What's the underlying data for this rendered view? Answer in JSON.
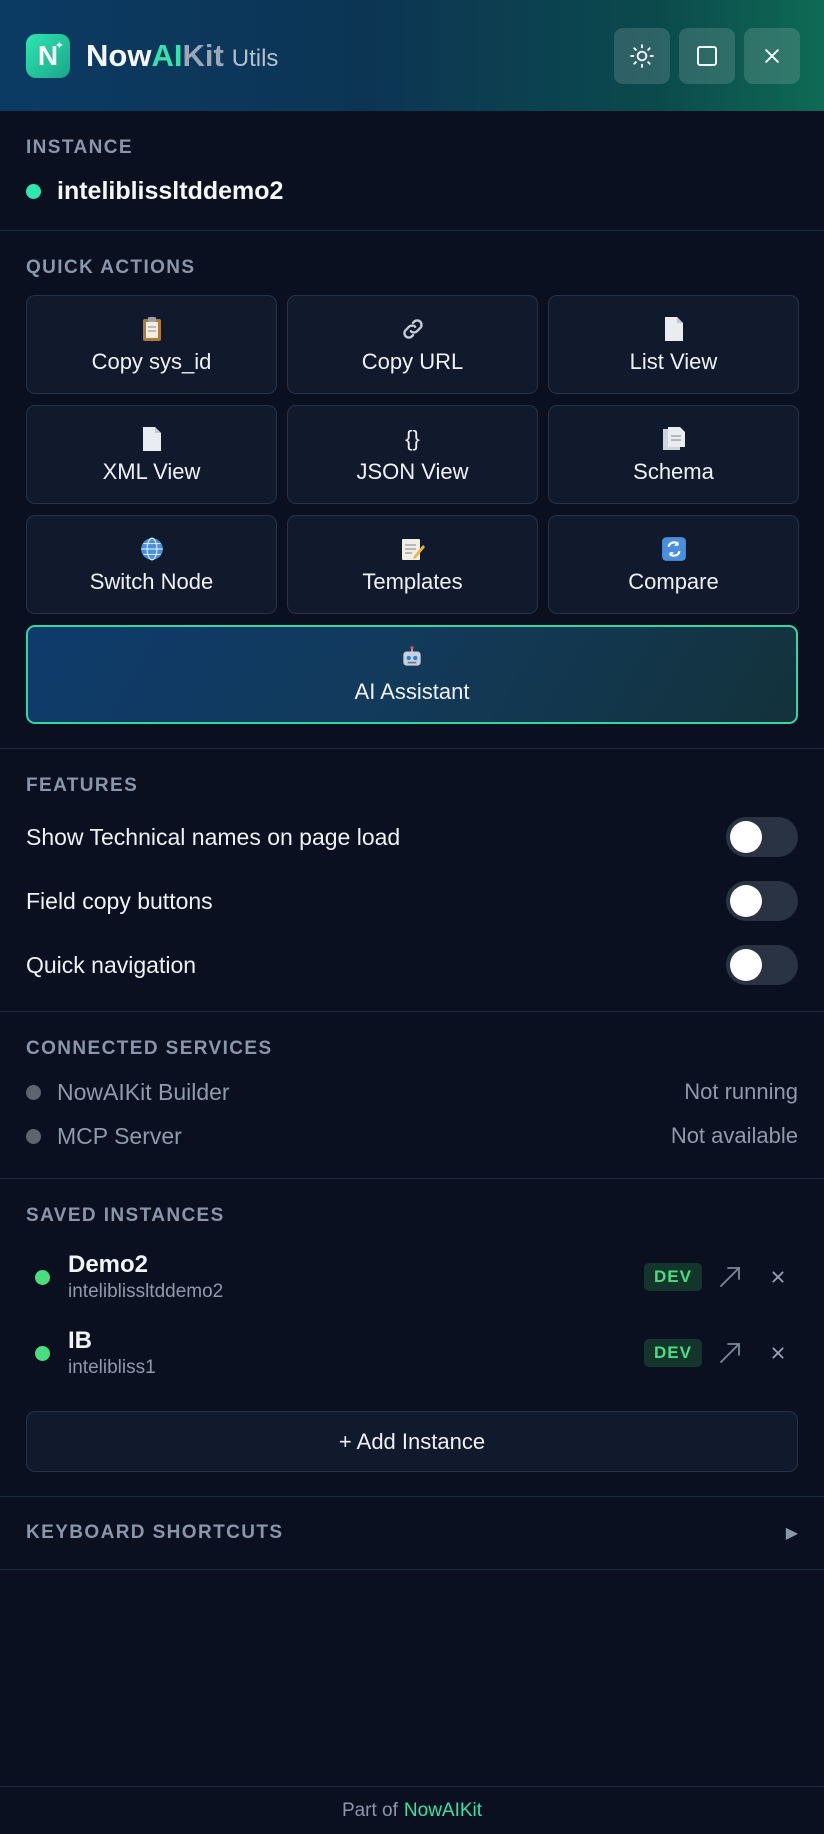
{
  "header": {
    "logo_letter": "N",
    "brand_now": "Now",
    "brand_ai": "AI",
    "brand_kit": "Kit",
    "brand_suffix": "Utils",
    "buttons": [
      {
        "icon": "sun-icon"
      },
      {
        "icon": "square-icon"
      },
      {
        "icon": "close-icon"
      }
    ]
  },
  "instance": {
    "title": "INSTANCE",
    "name": "inteliblissltddemo2",
    "status_color": "#2ee6b0"
  },
  "quick_actions": {
    "title": "QUICK ACTIONS",
    "items": [
      {
        "label": "Copy sys_id",
        "icon": "clipboard-icon"
      },
      {
        "label": "Copy URL",
        "icon": "link-icon"
      },
      {
        "label": "List View",
        "icon": "document-icon"
      },
      {
        "label": "XML View",
        "icon": "document-icon"
      },
      {
        "label": "JSON View",
        "icon": "braces-icon",
        "glyph": "{}"
      },
      {
        "label": "Schema",
        "icon": "schema-icon"
      },
      {
        "label": "Switch Node",
        "icon": "globe-icon"
      },
      {
        "label": "Templates",
        "icon": "memo-icon"
      },
      {
        "label": "Compare",
        "icon": "refresh-icon"
      }
    ],
    "ai_assistant": {
      "label": "AI Assistant",
      "icon": "robot-icon"
    }
  },
  "features": {
    "title": "FEATURES",
    "items": [
      {
        "label": "Show Technical names on page load",
        "enabled": false
      },
      {
        "label": "Field copy buttons",
        "enabled": false
      },
      {
        "label": "Quick navigation",
        "enabled": false
      }
    ]
  },
  "services": {
    "title": "CONNECTED SERVICES",
    "items": [
      {
        "name": "NowAIKit Builder",
        "status": "Not running"
      },
      {
        "name": "MCP Server",
        "status": "Not available"
      }
    ]
  },
  "saved_instances": {
    "title": "SAVED INSTANCES",
    "items": [
      {
        "name": "Demo2",
        "host": "inteliblissltddemo2",
        "badge": "DEV"
      },
      {
        "name": "IB",
        "host": "intelibliss1",
        "badge": "DEV"
      }
    ],
    "add_label": "+ Add Instance"
  },
  "shortcuts": {
    "title": "KEYBOARD SHORTCUTS",
    "arrow": "▶"
  },
  "footer": {
    "prefix": "Part of",
    "link": "NowAIKit"
  },
  "colors": {
    "accent": "#34e3a8",
    "background": "#0b1020",
    "status_green": "#4ade80"
  }
}
